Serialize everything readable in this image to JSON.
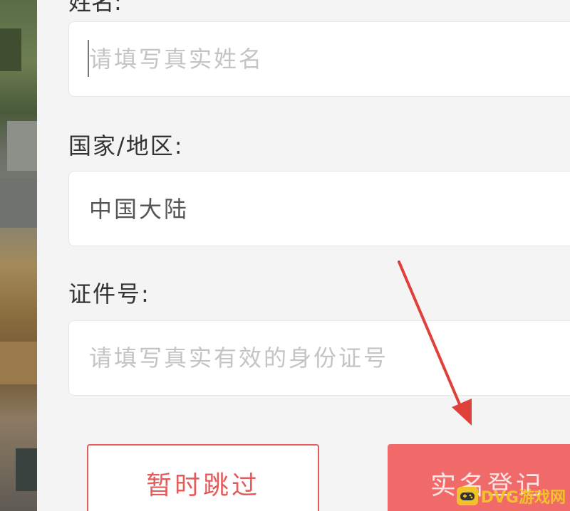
{
  "form": {
    "name_label_partial": "姓名:",
    "name_placeholder": "请填写真实姓名",
    "country_label": "国家/地区:",
    "country_value": "中国大陆",
    "id_label": "证件号:",
    "id_placeholder": "请填写真实有效的身份证号"
  },
  "buttons": {
    "skip_label": "暂时跳过",
    "register_label": "实名登记"
  },
  "watermark": {
    "text": "DVG游戏网"
  },
  "colors": {
    "accent": "#f06a6a",
    "skip_border": "#e45b5b",
    "annotation_arrow": "#e0403a",
    "watermark": "#f3c12a"
  },
  "icons": {
    "watermark_logo": "gamepad-icon",
    "annotation": "red-arrow-icon"
  }
}
